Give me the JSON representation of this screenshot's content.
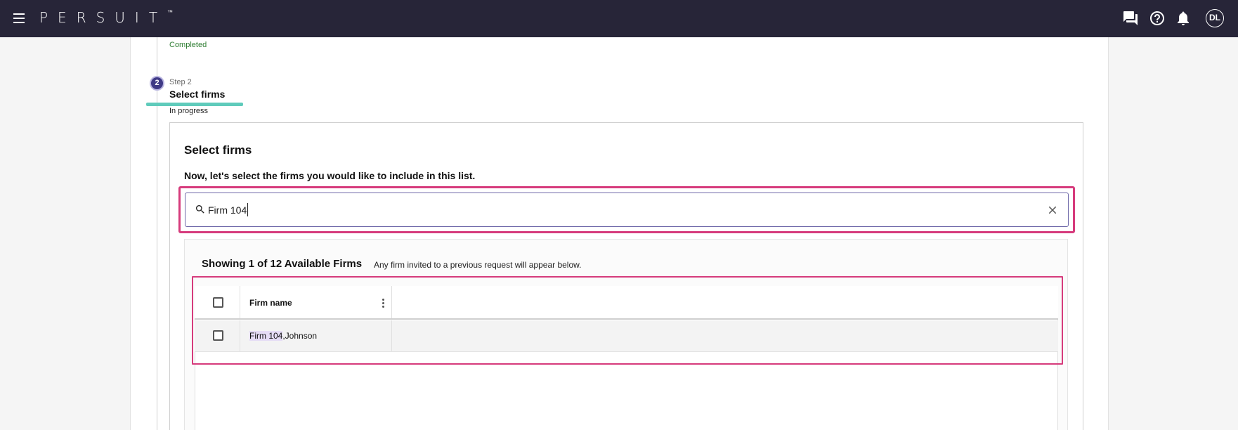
{
  "app": {
    "logo": "PERSUIT",
    "trademark": "™",
    "user_initials": "DL"
  },
  "icons": {
    "menu": "hamburger-menu-icon",
    "chat": "chat-icon",
    "help": "help-icon",
    "notifications": "bell-icon",
    "search": "search-icon",
    "clear": "close-icon",
    "column_menu": "more-vert-icon"
  },
  "stepper": {
    "previous_status": "Completed",
    "current": {
      "number": "2",
      "label": "Step 2",
      "title": "Select firms",
      "status": "In progress"
    }
  },
  "panel": {
    "title": "Select firms",
    "subtitle": "Now, let's select the firms you would like to include in this list."
  },
  "search": {
    "value": "Firm 104",
    "placeholder": ""
  },
  "results": {
    "heading": "Showing 1 of 12 Available Firms",
    "note": "Any firm invited to a previous request will appear below.",
    "columns": [
      "Firm name"
    ],
    "rows": [
      {
        "match": "Firm 104",
        "rest": ",Johnson",
        "checked": false
      }
    ]
  },
  "colors": {
    "topbar": "#272538",
    "accent": "#3f3a86",
    "progress": "#5fcbbb",
    "highlight_border": "#d63b7c",
    "completed_text": "#2e7d32"
  }
}
